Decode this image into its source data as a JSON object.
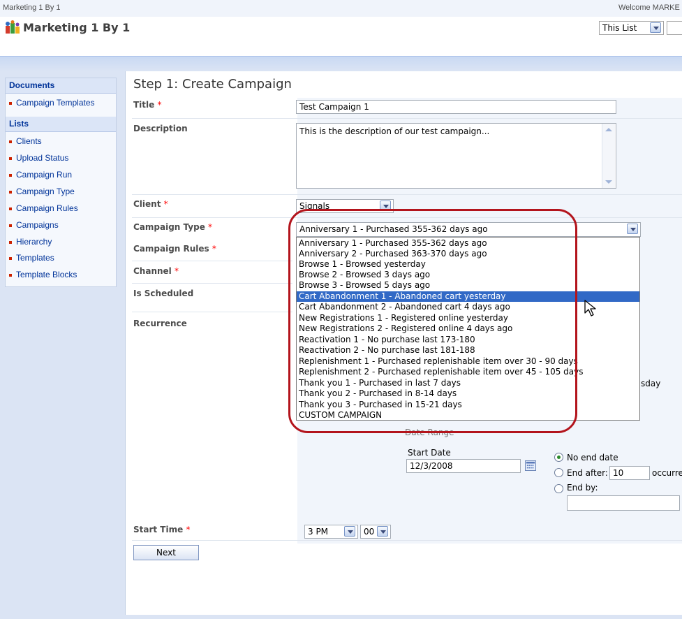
{
  "top": {
    "site_name": "Marketing 1 By 1",
    "welcome": "Welcome MARKE"
  },
  "header": {
    "title": "Marketing 1 By 1",
    "scope_select": "This List",
    "search_value": ""
  },
  "nav": {
    "documents_header": "Documents",
    "documents_items": [
      "Campaign Templates"
    ],
    "lists_header": "Lists",
    "lists_items": [
      "Clients",
      "Upload Status",
      "Campaign Run",
      "Campaign Type",
      "Campaign Rules",
      "Campaigns",
      "Hierarchy",
      "Templates",
      "Template Blocks"
    ]
  },
  "page": {
    "title": "Step 1: Create Campaign"
  },
  "form": {
    "required_mark": "*",
    "title_label": "Title",
    "title_value": "Test Campaign 1",
    "description_label": "Description",
    "description_value": "This is the description of our test campaign...",
    "client_label": "Client",
    "client_value": "Signals",
    "campaign_type_label": "Campaign Type",
    "campaign_type_value": "Anniversary 1 - Purchased 355-362 days ago",
    "campaign_rules_label": "Campaign Rules",
    "channel_label": "Channel",
    "is_scheduled_label": "Is Scheduled",
    "recurrence_label": "Recurrence",
    "recurrence_partial_day": "sday",
    "date_range_label": "Date Range",
    "start_date_label": "Start Date",
    "start_date_value": "12/3/2008",
    "no_end_date_label": "No end date",
    "end_after_label": "End after:",
    "end_after_value": "10",
    "occurrences_label": "occurre",
    "end_by_label": "End by:",
    "end_by_value": "",
    "start_time_label": "Start Time",
    "start_hour": "3 PM",
    "start_minute": "00",
    "next_button": "Next"
  },
  "dropdown": {
    "selected_index": 5,
    "options": [
      "Anniversary 1 - Purchased 355-362 days ago",
      "Anniversary 2 - Purchased 363-370 days ago",
      "Browse 1 - Browsed yesterday",
      "Browse 2 - Browsed 3 days ago",
      "Browse 3 - Browsed 5 days ago",
      "Cart Abandonment 1 - Abandoned cart yesterday",
      "Cart Abandonment 2 - Abandoned cart 4 days ago",
      "New Registrations 1 - Registered online yesterday",
      "New Registrations 2 - Registered online 4 days ago",
      "Reactivation 1 - No purchase last 173-180",
      "Reactivation 2 - No purchase last 181-188",
      "Replenishment 1 - Purchased replenishable item over 30 - 90 days",
      "Replenishment 2 - Purchased replenishable item over 45 - 105 days",
      "Thank you 1 - Purchased in last 7 days",
      "Thank you 2 - Purchased in 8-14 days",
      "Thank you 3 - Purchased in 15-21 days",
      "CUSTOM CAMPAIGN"
    ]
  },
  "colors": {
    "nav_link": "#003399",
    "selection": "#3169c6",
    "highlight_ring": "#b3141c",
    "required": "#ff0000"
  }
}
